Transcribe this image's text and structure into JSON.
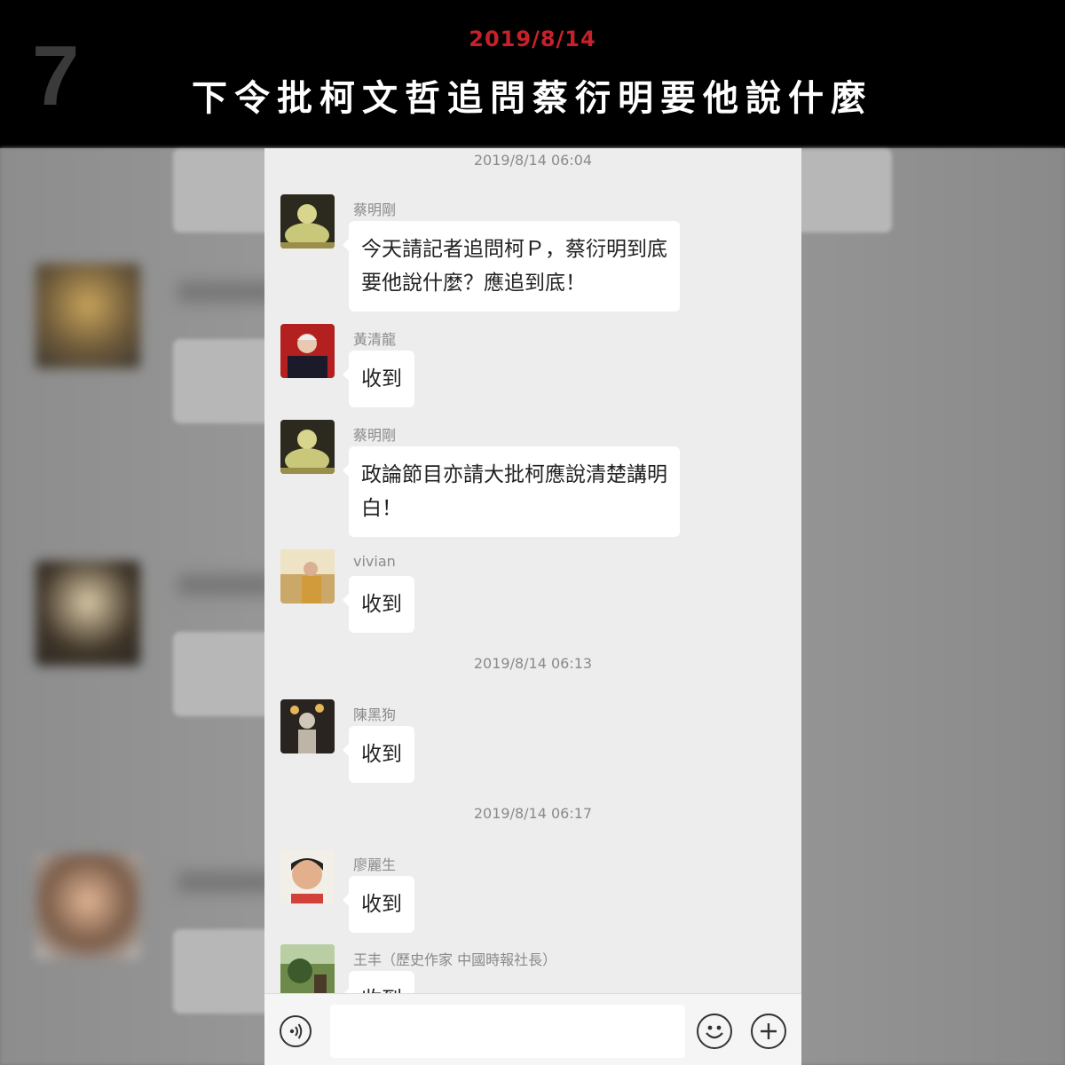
{
  "banner": {
    "number": "7",
    "date": "2019/8/14",
    "title": "下令批柯文哲追問蔡衍明要他說什麼"
  },
  "chat": {
    "top_timestamp": "2019/8/14 06:04",
    "messages": [
      {
        "sender": "蔡明剛",
        "lines": [
          "今天請記者追問柯Ｐ，蔡衍明到底",
          "要他說什麼？應追到底！"
        ]
      },
      {
        "sender": "黃清龍",
        "lines": [
          "收到"
        ]
      },
      {
        "sender": "蔡明剛",
        "lines": [
          "政論節目亦請大批柯應說清楚講明",
          "白！"
        ]
      },
      {
        "sender": "vivian",
        "lines": [
          "收到"
        ]
      },
      {
        "sender": "陳黑狗",
        "lines": [
          "收到"
        ]
      },
      {
        "sender": "廖麗生",
        "lines": [
          "收到"
        ]
      },
      {
        "sender": "王丰（歷史作家 中國時報社長）",
        "lines": [
          "收到"
        ]
      }
    ],
    "timestamps": [
      "2019/8/14 06:13",
      "2019/8/14 06:17"
    ]
  },
  "input_bar": {
    "voice_icon": "voice-icon",
    "emoji_icon": "emoji-icon",
    "plus_icon": "plus-icon"
  },
  "colors": {
    "accent_red": "#c8202a",
    "banner_bg": "#000000",
    "chat_bg": "#ededed"
  }
}
